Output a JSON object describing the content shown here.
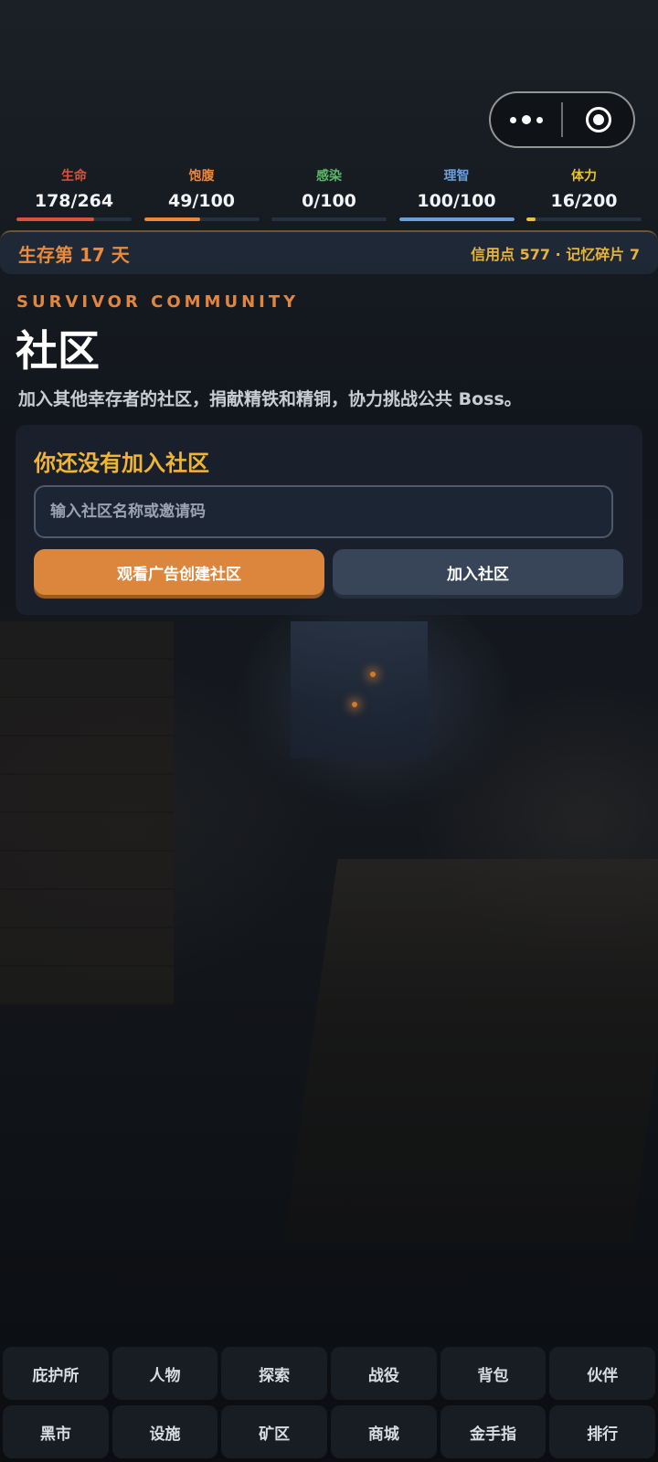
{
  "stats": [
    {
      "label": "生命",
      "value": "178/264",
      "color": "#d8533b",
      "fill": 0.674
    },
    {
      "label": "饱腹",
      "value": "49/100",
      "color": "#e9883b",
      "fill": 0.49
    },
    {
      "label": "感染",
      "value": "0/100",
      "color": "#5cb86a",
      "fill": 0.0
    },
    {
      "label": "理智",
      "value": "100/100",
      "color": "#6b9fd9",
      "fill": 1.0
    },
    {
      "label": "体力",
      "value": "16/200",
      "color": "#e9c13a",
      "fill": 0.08
    }
  ],
  "status": {
    "day": "生存第 17 天",
    "resources": "信用点 577 · 记忆碎片 7"
  },
  "header": {
    "subtitle": "SURVIVOR COMMUNITY",
    "title": "社区",
    "description": "加入其他幸存者的社区，捐献精铁和精铜，协力挑战公共 Boss。"
  },
  "community_card": {
    "heading": "你还没有加入社区",
    "input_placeholder": "输入社区名称或邀请码",
    "create_button": "观看广告创建社区",
    "join_button": "加入社区"
  },
  "nav": {
    "row1": [
      "庇护所",
      "人物",
      "探索",
      "战役",
      "背包",
      "伙伴"
    ],
    "row2": [
      "黑市",
      "设施",
      "矿区",
      "商城",
      "金手指",
      "排行"
    ]
  },
  "colors": {
    "accent_orange": "#dc853d",
    "accent_gold": "#f0b535"
  }
}
